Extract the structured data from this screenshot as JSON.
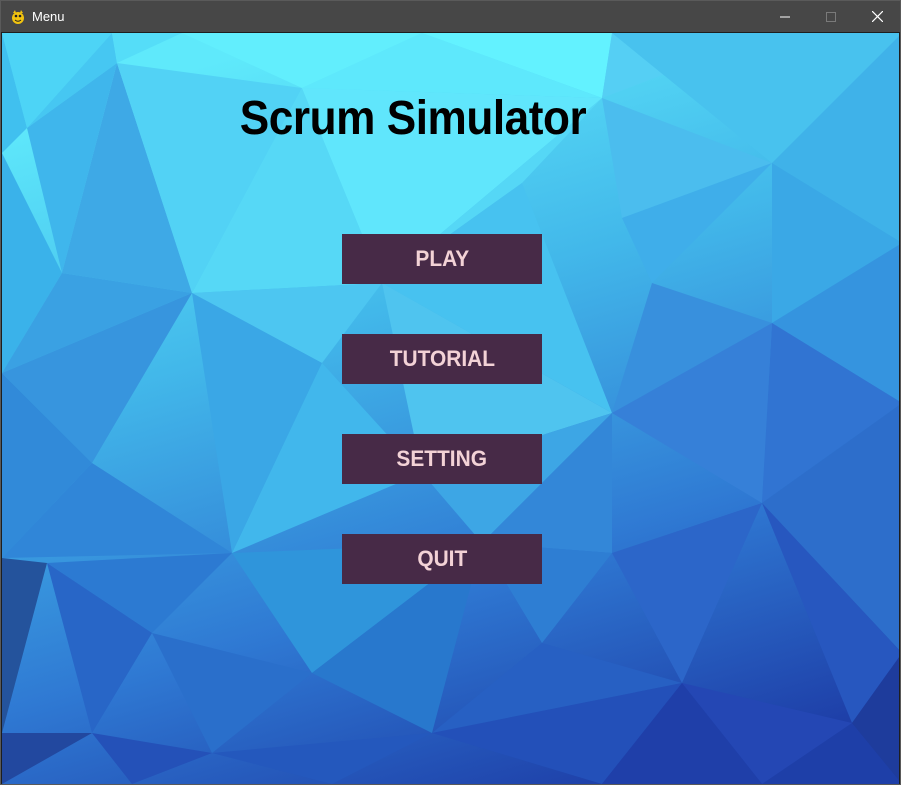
{
  "window": {
    "title": "Menu",
    "icon": "pygame-snake-icon",
    "controls": [
      "minimize-icon",
      "maximize-icon",
      "close-icon"
    ]
  },
  "game": {
    "title": "Scrum Simulator"
  },
  "menu": {
    "buttons": [
      {
        "label": "PLAY"
      },
      {
        "label": "TUTORIAL"
      },
      {
        "label": "SETTING"
      },
      {
        "label": "QUIT"
      }
    ]
  },
  "colors": {
    "titlebar": "#474747",
    "button_bg": "#472a47",
    "button_text": "#f3d2d6",
    "title_text": "#000000",
    "bg_light": "#62f0ff",
    "bg_dark": "#1c3aa0"
  }
}
